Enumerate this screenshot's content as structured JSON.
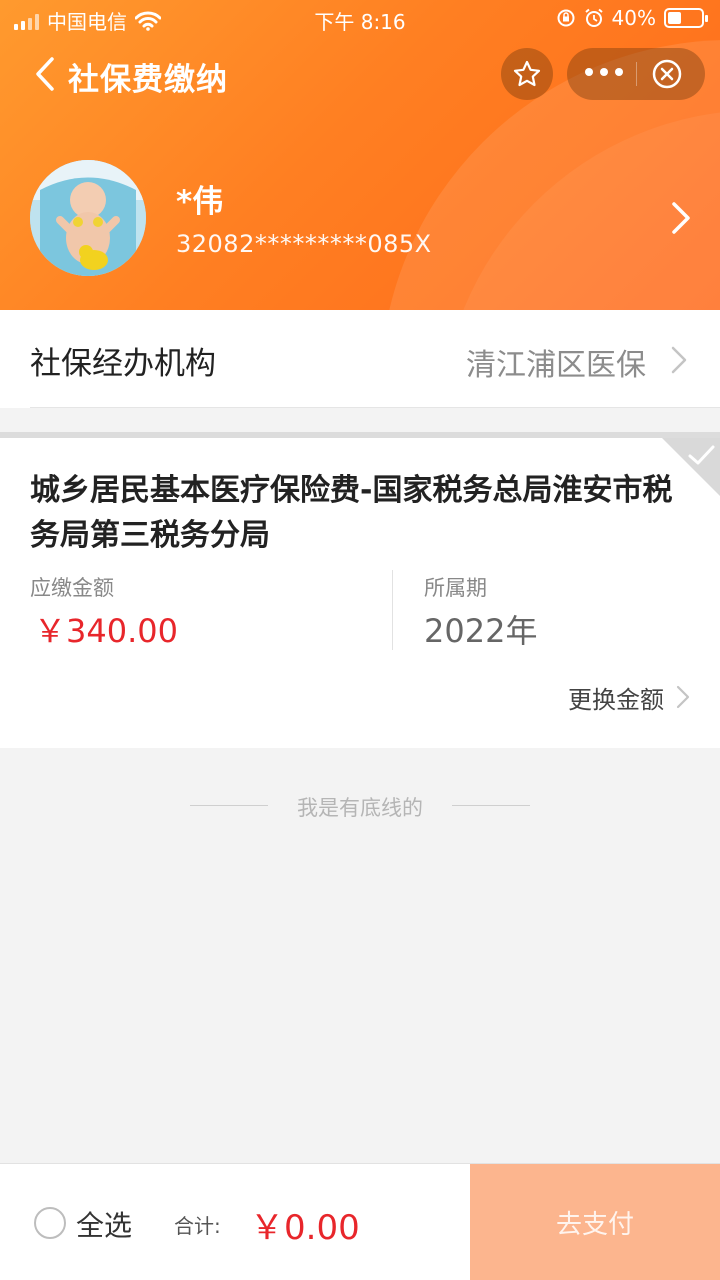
{
  "status_bar": {
    "carrier": "中国电信",
    "time": "下午 8:16",
    "battery": "40%",
    "battery_level": 0.4
  },
  "nav": {
    "title": "社保费缴纳"
  },
  "profile": {
    "name": "*伟",
    "id_number": "32082*********085X"
  },
  "agency": {
    "label": "社保经办机构",
    "value": "清江浦区医保"
  },
  "item": {
    "title": "城乡居民基本医疗保险费-国家税务总局淮安市税务局第三税务分局",
    "amount_label": "应缴金额",
    "amount": "￥340.00",
    "period_label": "所属期",
    "period": "2022年",
    "change_amount": "更换金额",
    "selected": true
  },
  "bottom_line": "我是有底线的",
  "footer": {
    "select_all": "全选",
    "total_label": "合计:",
    "total": "￥0.00",
    "pay_button": "去支付"
  },
  "colors": {
    "header_orange": "#ff7f22",
    "price_red": "#e8262b",
    "pay_button_disabled": "#fcb58e"
  },
  "icons": [
    "back-chevron-icon",
    "star-icon",
    "more-dots-icon",
    "close-circle-icon",
    "chevron-right-icon",
    "check-icon"
  ]
}
